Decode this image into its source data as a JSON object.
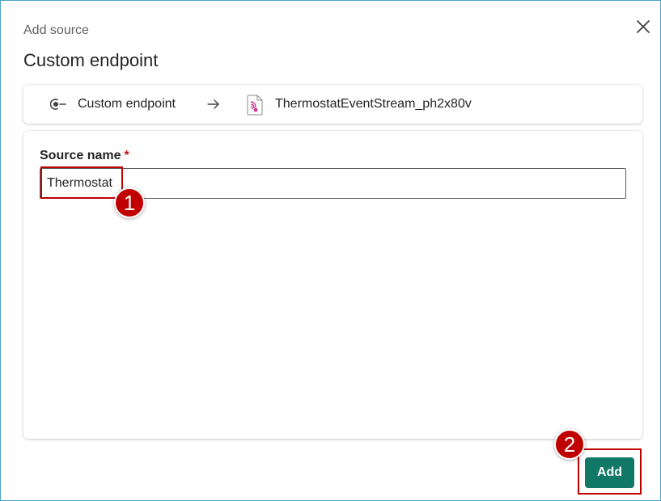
{
  "dialog": {
    "subtitle": "Add source",
    "title": "Custom endpoint",
    "close_icon": "close-icon"
  },
  "flow": {
    "source_icon": "custom-endpoint-icon",
    "source_label": "Custom endpoint",
    "arrow_icon": "arrow-right-icon",
    "destination_icon": "eventstream-icon",
    "destination_label": "ThermostatEventStream_ph2x80v"
  },
  "form": {
    "source_name_label": "Source name",
    "required_marker": "*",
    "source_name_value": "Thermostat"
  },
  "footer": {
    "add_label": "Add"
  },
  "annotations": {
    "step1": "1",
    "step2": "2",
    "highlight_color": "#c00000"
  },
  "colors": {
    "primary_button": "#117865",
    "required": "#c50f1f"
  }
}
